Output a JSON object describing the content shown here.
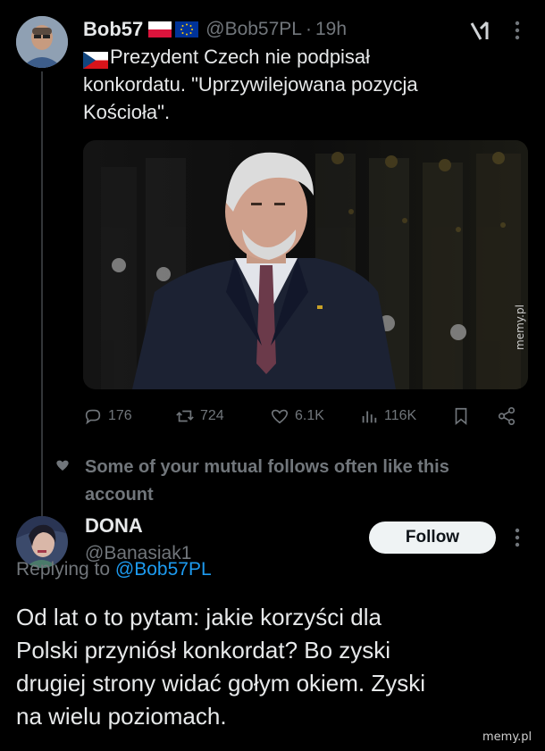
{
  "tweet": {
    "author_name": "Bob57",
    "handle": "@Bob57PL",
    "separator": "·",
    "time": "19h",
    "flag_text": "Prezydent Czech nie podpisał",
    "text_line2": "konkordatu. \"Uprzywilejowana pozycja",
    "text_line3": "Kościoła\".",
    "stats": {
      "replies": "176",
      "retweets": "724",
      "likes": "6.1K",
      "views": "116K"
    }
  },
  "social_context": {
    "line1": "Some of your mutual follows often like this",
    "line2": "account"
  },
  "reply": {
    "author_name": "DONA",
    "handle": "@Banasiak1",
    "follow_label": "Follow",
    "replying_to_prefix": "Replying to",
    "replying_to_handle": "@Bob57PL",
    "text_lines": [
      "Od lat o to pytam: jakie korzyści dla",
      "Polski przyniósł konkordat? Bo zyski",
      "drugiej strony widać gołym okiem. Zyski",
      "na wielu poziomach."
    ]
  },
  "watermarks": {
    "side": "memy.pl",
    "bottom": "memy.pl"
  },
  "colors": {
    "background": "#000000",
    "text_primary": "#e7e9ea",
    "text_secondary": "#71767b",
    "link": "#1d9bf0",
    "follow_button_bg": "#eff3f4"
  },
  "icons": [
    "grok-icon",
    "more-icon",
    "reply-icon",
    "retweet-icon",
    "like-icon",
    "views-icon",
    "bookmark-icon",
    "share-icon",
    "heart-icon",
    "czech-flag-icon",
    "poland-flag-icon",
    "eu-flag-icon"
  ]
}
